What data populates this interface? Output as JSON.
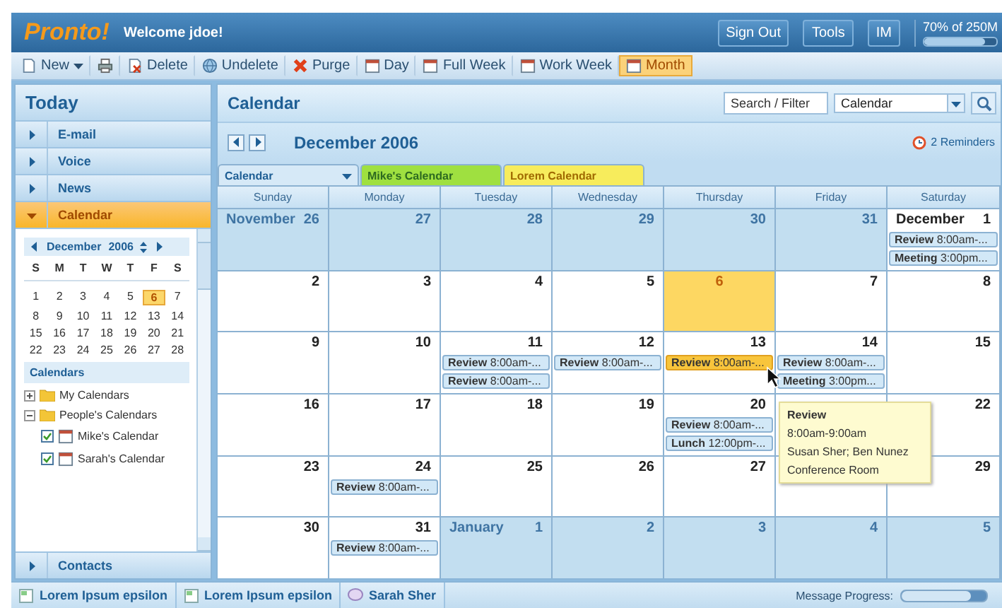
{
  "top_bar": {
    "logo": "Pronto!",
    "welcome": "Welcome jdoe!",
    "buttons": [
      "Sign Out",
      "Tools",
      "IM"
    ],
    "memory": {
      "label": "70% of 250M",
      "level": 0.85
    }
  },
  "toolbar": [
    {
      "kind": "new",
      "label": "New",
      "selected": false
    },
    {
      "kind": "print",
      "selected": false
    },
    {
      "kind": "delete",
      "label": "Delete",
      "selected": false
    },
    {
      "kind": "undelete",
      "label": "Undelete",
      "selected": false
    },
    {
      "kind": "purge",
      "label": "Purge",
      "selected": false
    },
    {
      "kind": "view",
      "label": "Day",
      "selected": false
    },
    {
      "kind": "view",
      "label": "Full Week",
      "selected": false
    },
    {
      "kind": "view",
      "label": "Work Week",
      "selected": false
    },
    {
      "kind": "view",
      "label": "Month",
      "selected": true
    }
  ],
  "sidebar": {
    "title": "Today",
    "sections": [
      {
        "label": "E-mail",
        "expanded": false
      },
      {
        "label": "Voice",
        "expanded": false
      },
      {
        "label": "News",
        "expanded": false
      },
      {
        "label": "Calendar",
        "expanded": true
      },
      {
        "label": "Contacts",
        "expanded": false
      }
    ],
    "mini_calendar": {
      "month": "December",
      "year": "2006",
      "weekdays": [
        "S",
        "M",
        "T",
        "W",
        "T",
        "F",
        "S"
      ],
      "days": [
        {
          "label": "1",
          "selected": false
        },
        {
          "label": "2",
          "selected": false
        },
        {
          "label": "3",
          "selected": false
        },
        {
          "label": "4",
          "selected": false
        },
        {
          "label": "5",
          "selected": false
        },
        {
          "label": "6",
          "selected": true
        },
        {
          "label": "7",
          "selected": false
        },
        {
          "label": "8",
          "selected": false
        },
        {
          "label": "9",
          "selected": false
        },
        {
          "label": "10",
          "selected": false
        },
        {
          "label": "11",
          "selected": false
        },
        {
          "label": "12",
          "selected": false
        },
        {
          "label": "13",
          "selected": false
        },
        {
          "label": "14",
          "selected": false
        },
        {
          "label": "15",
          "selected": false
        },
        {
          "label": "16",
          "selected": false
        },
        {
          "label": "17",
          "selected": false
        },
        {
          "label": "18",
          "selected": false
        },
        {
          "label": "19",
          "selected": false
        },
        {
          "label": "20",
          "selected": false
        },
        {
          "label": "21",
          "selected": false
        },
        {
          "label": "22",
          "selected": false
        },
        {
          "label": "23",
          "selected": false
        },
        {
          "label": "24",
          "selected": false
        },
        {
          "label": "25",
          "selected": false
        },
        {
          "label": "26",
          "selected": false
        },
        {
          "label": "27",
          "selected": false
        },
        {
          "label": "28",
          "selected": false
        }
      ]
    },
    "calendars": {
      "heading": "Calendars",
      "tree": [
        {
          "label": "My Calendars",
          "expanded": false
        },
        {
          "label": "People's Calendars",
          "expanded": true,
          "children": [
            {
              "label": "Mike's Calendar",
              "checked": true
            },
            {
              "label": "Sarah's Calendar",
              "checked": true
            }
          ]
        }
      ]
    }
  },
  "main": {
    "title": "Calendar",
    "search": {
      "placeholder": "Search / Filter"
    },
    "scope": {
      "value": "Calendar"
    },
    "month_title": "December 2006",
    "reminders": "2 Reminders",
    "calendar_tabs": [
      {
        "kind": "dropdown",
        "label": "Calendar",
        "color": "#d6e9f7"
      },
      {
        "kind": "tab",
        "label": "Mike's Calendar",
        "color": "#9fe040"
      },
      {
        "kind": "tab",
        "label": "Lorem Calendar",
        "color": "#f7ec5c"
      }
    ],
    "weekdays": [
      "Sunday",
      "Monday",
      "Tuesday",
      "Wednesday",
      "Thursday",
      "Friday",
      "Saturday"
    ],
    "weeks": [
      [
        {
          "day": "26",
          "month_label": "November",
          "other_month": true,
          "today": false
        },
        {
          "day": "27",
          "other_month": true,
          "today": false
        },
        {
          "day": "28",
          "other_month": true,
          "today": false
        },
        {
          "day": "29",
          "other_month": true,
          "today": false
        },
        {
          "day": "30",
          "other_month": true,
          "today": false
        },
        {
          "day": "31",
          "other_month": true,
          "today": false
        },
        {
          "day": "1",
          "month_label": "December",
          "other_month": false,
          "today": false,
          "events": [
            {
              "title": "Review",
              "time": "8:00am-...",
              "selected": false
            },
            {
              "title": "Meeting",
              "time": "3:00pm...",
              "selected": false
            }
          ]
        }
      ],
      [
        {
          "day": "2",
          "other_month": false,
          "today": false
        },
        {
          "day": "3",
          "other_month": false,
          "today": false
        },
        {
          "day": "4",
          "other_month": false,
          "today": false
        },
        {
          "day": "5",
          "other_month": false,
          "today": false
        },
        {
          "day": "6",
          "other_month": false,
          "today": true
        },
        {
          "day": "7",
          "other_month": false,
          "today": false
        },
        {
          "day": "8",
          "other_month": false,
          "today": false
        }
      ],
      [
        {
          "day": "9",
          "other_month": false,
          "today": false
        },
        {
          "day": "10",
          "other_month": false,
          "today": false
        },
        {
          "day": "11",
          "other_month": false,
          "today": false,
          "events": [
            {
              "title": "Review",
              "time": "8:00am-...",
              "selected": false
            },
            {
              "title": "Review",
              "time": "8:00am-...",
              "selected": false
            }
          ]
        },
        {
          "day": "12",
          "other_month": false,
          "today": false,
          "events": [
            {
              "title": "Review",
              "time": "8:00am-...",
              "selected": false
            }
          ]
        },
        {
          "day": "13",
          "other_month": false,
          "today": false,
          "events": [
            {
              "title": "Review",
              "time": "8:00am-...",
              "selected": true
            }
          ]
        },
        {
          "day": "14",
          "other_month": false,
          "today": false,
          "events": [
            {
              "title": "Review",
              "time": "8:00am-...",
              "selected": false
            },
            {
              "title": "Meeting",
              "time": "3:00pm...",
              "selected": false
            }
          ]
        },
        {
          "day": "15",
          "other_month": false,
          "today": false
        }
      ],
      [
        {
          "day": "16",
          "other_month": false,
          "today": false
        },
        {
          "day": "17",
          "other_month": false,
          "today": false
        },
        {
          "day": "18",
          "other_month": false,
          "today": false
        },
        {
          "day": "19",
          "other_month": false,
          "today": false
        },
        {
          "day": "20",
          "other_month": false,
          "today": false,
          "events": [
            {
              "title": "Review",
              "time": "8:00am-...",
              "selected": false
            },
            {
              "title": "Lunch",
              "time": "12:00pm-...",
              "selected": false
            }
          ]
        },
        {
          "other_month": false,
          "today": false
        },
        {
          "day": "22",
          "other_month": false,
          "today": false
        }
      ],
      [
        {
          "day": "23",
          "other_month": false,
          "today": false
        },
        {
          "day": "24",
          "other_month": false,
          "today": false,
          "events": [
            {
              "title": "Review",
              "time": "8:00am-...",
              "selected": false
            }
          ]
        },
        {
          "day": "25",
          "other_month": false,
          "today": false
        },
        {
          "day": "26",
          "other_month": false,
          "today": false
        },
        {
          "day": "27",
          "other_month": false,
          "today": false
        },
        {
          "other_month": false,
          "today": false
        },
        {
          "day": "29",
          "other_month": false,
          "today": false
        }
      ],
      [
        {
          "day": "30",
          "other_month": false,
          "today": false
        },
        {
          "day": "31",
          "other_month": false,
          "today": false,
          "events": [
            {
              "title": "Review",
              "time": "8:00am-...",
              "selected": false
            }
          ]
        },
        {
          "day": "1",
          "month_label": "January",
          "other_month": true,
          "today": false
        },
        {
          "day": "2",
          "other_month": true,
          "today": false
        },
        {
          "day": "3",
          "other_month": true,
          "today": false
        },
        {
          "day": "4",
          "other_month": true,
          "today": false
        },
        {
          "day": "5",
          "other_month": true,
          "today": false
        }
      ]
    ],
    "tooltip": {
      "title": "Review",
      "lines": [
        "8:00am-9:00am",
        "Susan Sher; Ben Nunez",
        "Conference Room"
      ]
    }
  },
  "status_bar": {
    "tabs": [
      {
        "kind": "document",
        "label": "Lorem Ipsum epsilon"
      },
      {
        "kind": "document",
        "label": "Lorem Ipsum epsilon"
      },
      {
        "kind": "chat",
        "label": "Sarah Sher"
      }
    ],
    "progress": {
      "label": "Message Progress:",
      "level": 0.82
    }
  }
}
